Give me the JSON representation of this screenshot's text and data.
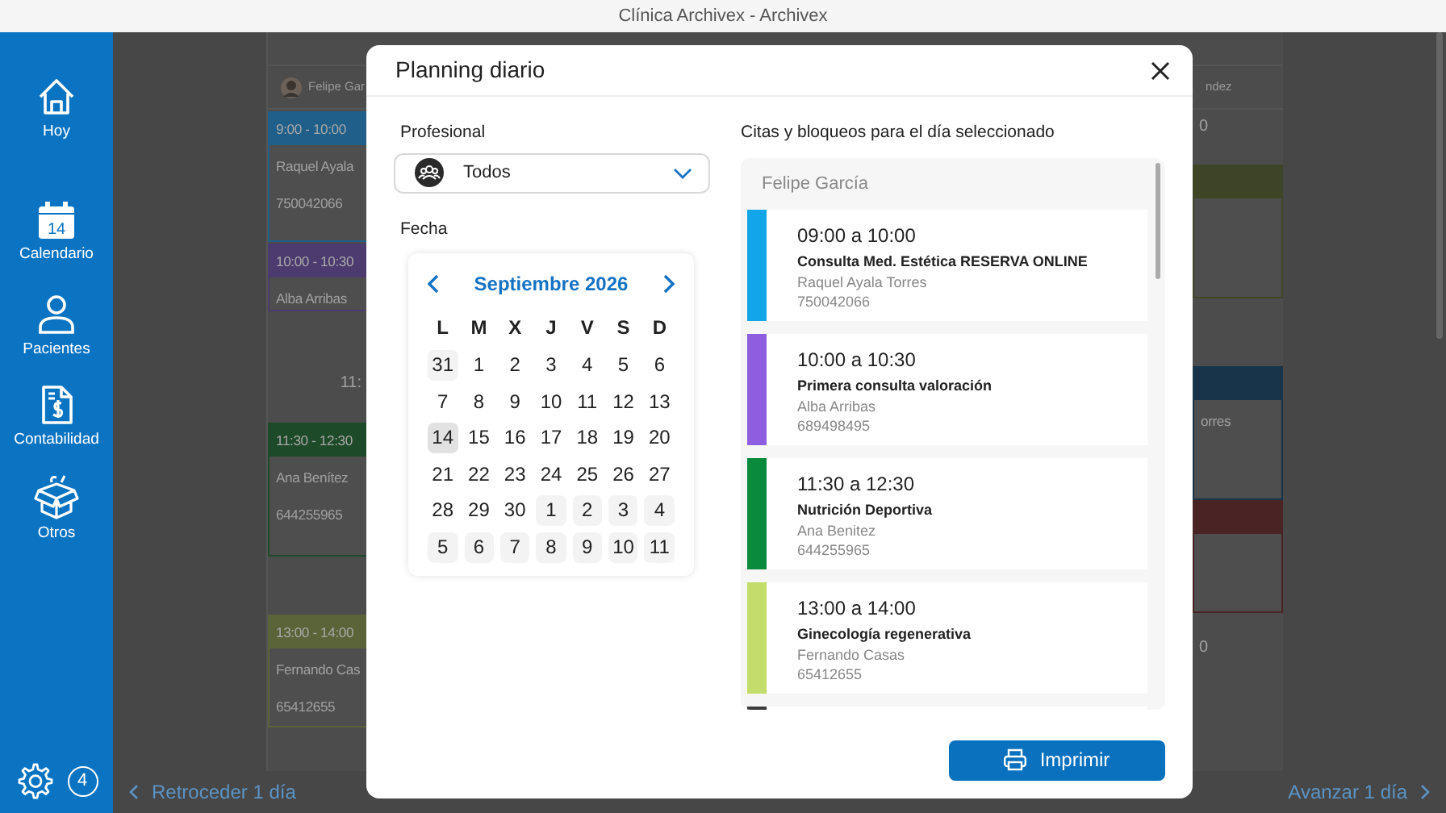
{
  "window": {
    "title": "Clínica Archivex - Archivex"
  },
  "sidebar": {
    "items": [
      {
        "label": "Hoy"
      },
      {
        "label": "Calendario",
        "icon_text": "14"
      },
      {
        "label": "Pacientes"
      },
      {
        "label": "Contabilidad"
      },
      {
        "label": "Otros"
      }
    ],
    "notification_count": "4"
  },
  "schedule": {
    "left_column": {
      "professional": "Felipe Gar",
      "slots": [
        {
          "kind": "event",
          "time": "9:00 - 10:00",
          "lines": [
            "Raquel Ayala",
            "750042066"
          ],
          "color": "#1f5f8a"
        },
        {
          "kind": "event",
          "time": "10:00 - 10:30",
          "lines": [
            "Alba Arribas"
          ],
          "color": "#4c3b6e"
        },
        {
          "kind": "label",
          "text": "11:"
        },
        {
          "kind": "event",
          "time": "11:30 - 12:30",
          "lines": [
            "Ana Benítez",
            "644255965"
          ],
          "color": "#1d4a28"
        },
        {
          "kind": "event",
          "time": "13:00 - 14:00",
          "lines": [
            "Fernando Cas",
            "65412655"
          ],
          "color": "#5b6338"
        }
      ]
    },
    "right_column": {
      "professional": "ndez",
      "slots": [
        {
          "kind": "label",
          "text": "0"
        },
        {
          "kind": "event",
          "color": "#3e4526"
        },
        {
          "kind": "event",
          "lines": [
            "orres"
          ],
          "color": "#17344a"
        },
        {
          "kind": "event",
          "color": "#4a2424"
        },
        {
          "kind": "label",
          "text": "0"
        }
      ]
    },
    "back": "Retroceder 1 día",
    "forward": "Avanzar 1 día"
  },
  "dialog": {
    "title": "Planning diario",
    "professional_label": "Profesional",
    "professional_value": "Todos",
    "date_label": "Fecha",
    "calendar": {
      "month": "Septiembre 2026",
      "weekdays": [
        "L",
        "M",
        "X",
        "J",
        "V",
        "S",
        "D"
      ],
      "weeks": [
        [
          {
            "day": "31",
            "other_month": true,
            "selected": false
          },
          {
            "day": "1",
            "other_month": false,
            "selected": false
          },
          {
            "day": "2",
            "other_month": false,
            "selected": false
          },
          {
            "day": "3",
            "other_month": false,
            "selected": false
          },
          {
            "day": "4",
            "other_month": false,
            "selected": false
          },
          {
            "day": "5",
            "other_month": false,
            "selected": false
          },
          {
            "day": "6",
            "other_month": false,
            "selected": false
          }
        ],
        [
          {
            "day": "7",
            "other_month": false,
            "selected": false
          },
          {
            "day": "8",
            "other_month": false,
            "selected": false
          },
          {
            "day": "9",
            "other_month": false,
            "selected": false
          },
          {
            "day": "10",
            "other_month": false,
            "selected": false
          },
          {
            "day": "11",
            "other_month": false,
            "selected": false
          },
          {
            "day": "12",
            "other_month": false,
            "selected": false
          },
          {
            "day": "13",
            "other_month": false,
            "selected": false
          }
        ],
        [
          {
            "day": "14",
            "other_month": false,
            "selected": true
          },
          {
            "day": "15",
            "other_month": false,
            "selected": false
          },
          {
            "day": "16",
            "other_month": false,
            "selected": false
          },
          {
            "day": "17",
            "other_month": false,
            "selected": false
          },
          {
            "day": "18",
            "other_month": false,
            "selected": false
          },
          {
            "day": "19",
            "other_month": false,
            "selected": false
          },
          {
            "day": "20",
            "other_month": false,
            "selected": false
          }
        ],
        [
          {
            "day": "21",
            "other_month": false,
            "selected": false
          },
          {
            "day": "22",
            "other_month": false,
            "selected": false
          },
          {
            "day": "23",
            "other_month": false,
            "selected": false
          },
          {
            "day": "24",
            "other_month": false,
            "selected": false
          },
          {
            "day": "25",
            "other_month": false,
            "selected": false
          },
          {
            "day": "26",
            "other_month": false,
            "selected": false
          },
          {
            "day": "27",
            "other_month": false,
            "selected": false
          }
        ],
        [
          {
            "day": "28",
            "other_month": false,
            "selected": false
          },
          {
            "day": "29",
            "other_month": false,
            "selected": false
          },
          {
            "day": "30",
            "other_month": false,
            "selected": false
          },
          {
            "day": "1",
            "other_month": true,
            "selected": false
          },
          {
            "day": "2",
            "other_month": true,
            "selected": false
          },
          {
            "day": "3",
            "other_month": true,
            "selected": false
          },
          {
            "day": "4",
            "other_month": true,
            "selected": false
          }
        ],
        [
          {
            "day": "5",
            "other_month": true,
            "selected": false
          },
          {
            "day": "6",
            "other_month": true,
            "selected": false
          },
          {
            "day": "7",
            "other_month": true,
            "selected": false
          },
          {
            "day": "8",
            "other_month": true,
            "selected": false
          },
          {
            "day": "9",
            "other_month": true,
            "selected": false
          },
          {
            "day": "10",
            "other_month": true,
            "selected": false
          },
          {
            "day": "11",
            "other_month": true,
            "selected": false
          }
        ]
      ]
    },
    "list_label": "Citas y bloqueos para el día seleccionado",
    "list_professional": "Felipe García",
    "appointments": [
      {
        "time": "09:00 a 10:00",
        "title": "Consulta Med. Estética RESERVA ONLINE",
        "patient": "Raquel Ayala Torres",
        "phone": "750042066",
        "color": "#12a6e8"
      },
      {
        "time": "10:00 a 10:30",
        "title": "Primera consulta valoración",
        "patient": "Alba Arribas",
        "phone": "689498495",
        "color": "#8e5ee0"
      },
      {
        "time": "11:30 a 12:30",
        "title": "Nutrición Deportiva",
        "patient": "Ana Benitez",
        "phone": "644255965",
        "color": "#0a8a3c"
      },
      {
        "time": "13:00 a 14:00",
        "title": "Ginecología regenerativa",
        "patient": "Fernando Casas",
        "phone": "65412655",
        "color": "#c3dc6c"
      },
      {
        "color": "#3b3b3b"
      }
    ],
    "print_button": "Imprimir"
  }
}
